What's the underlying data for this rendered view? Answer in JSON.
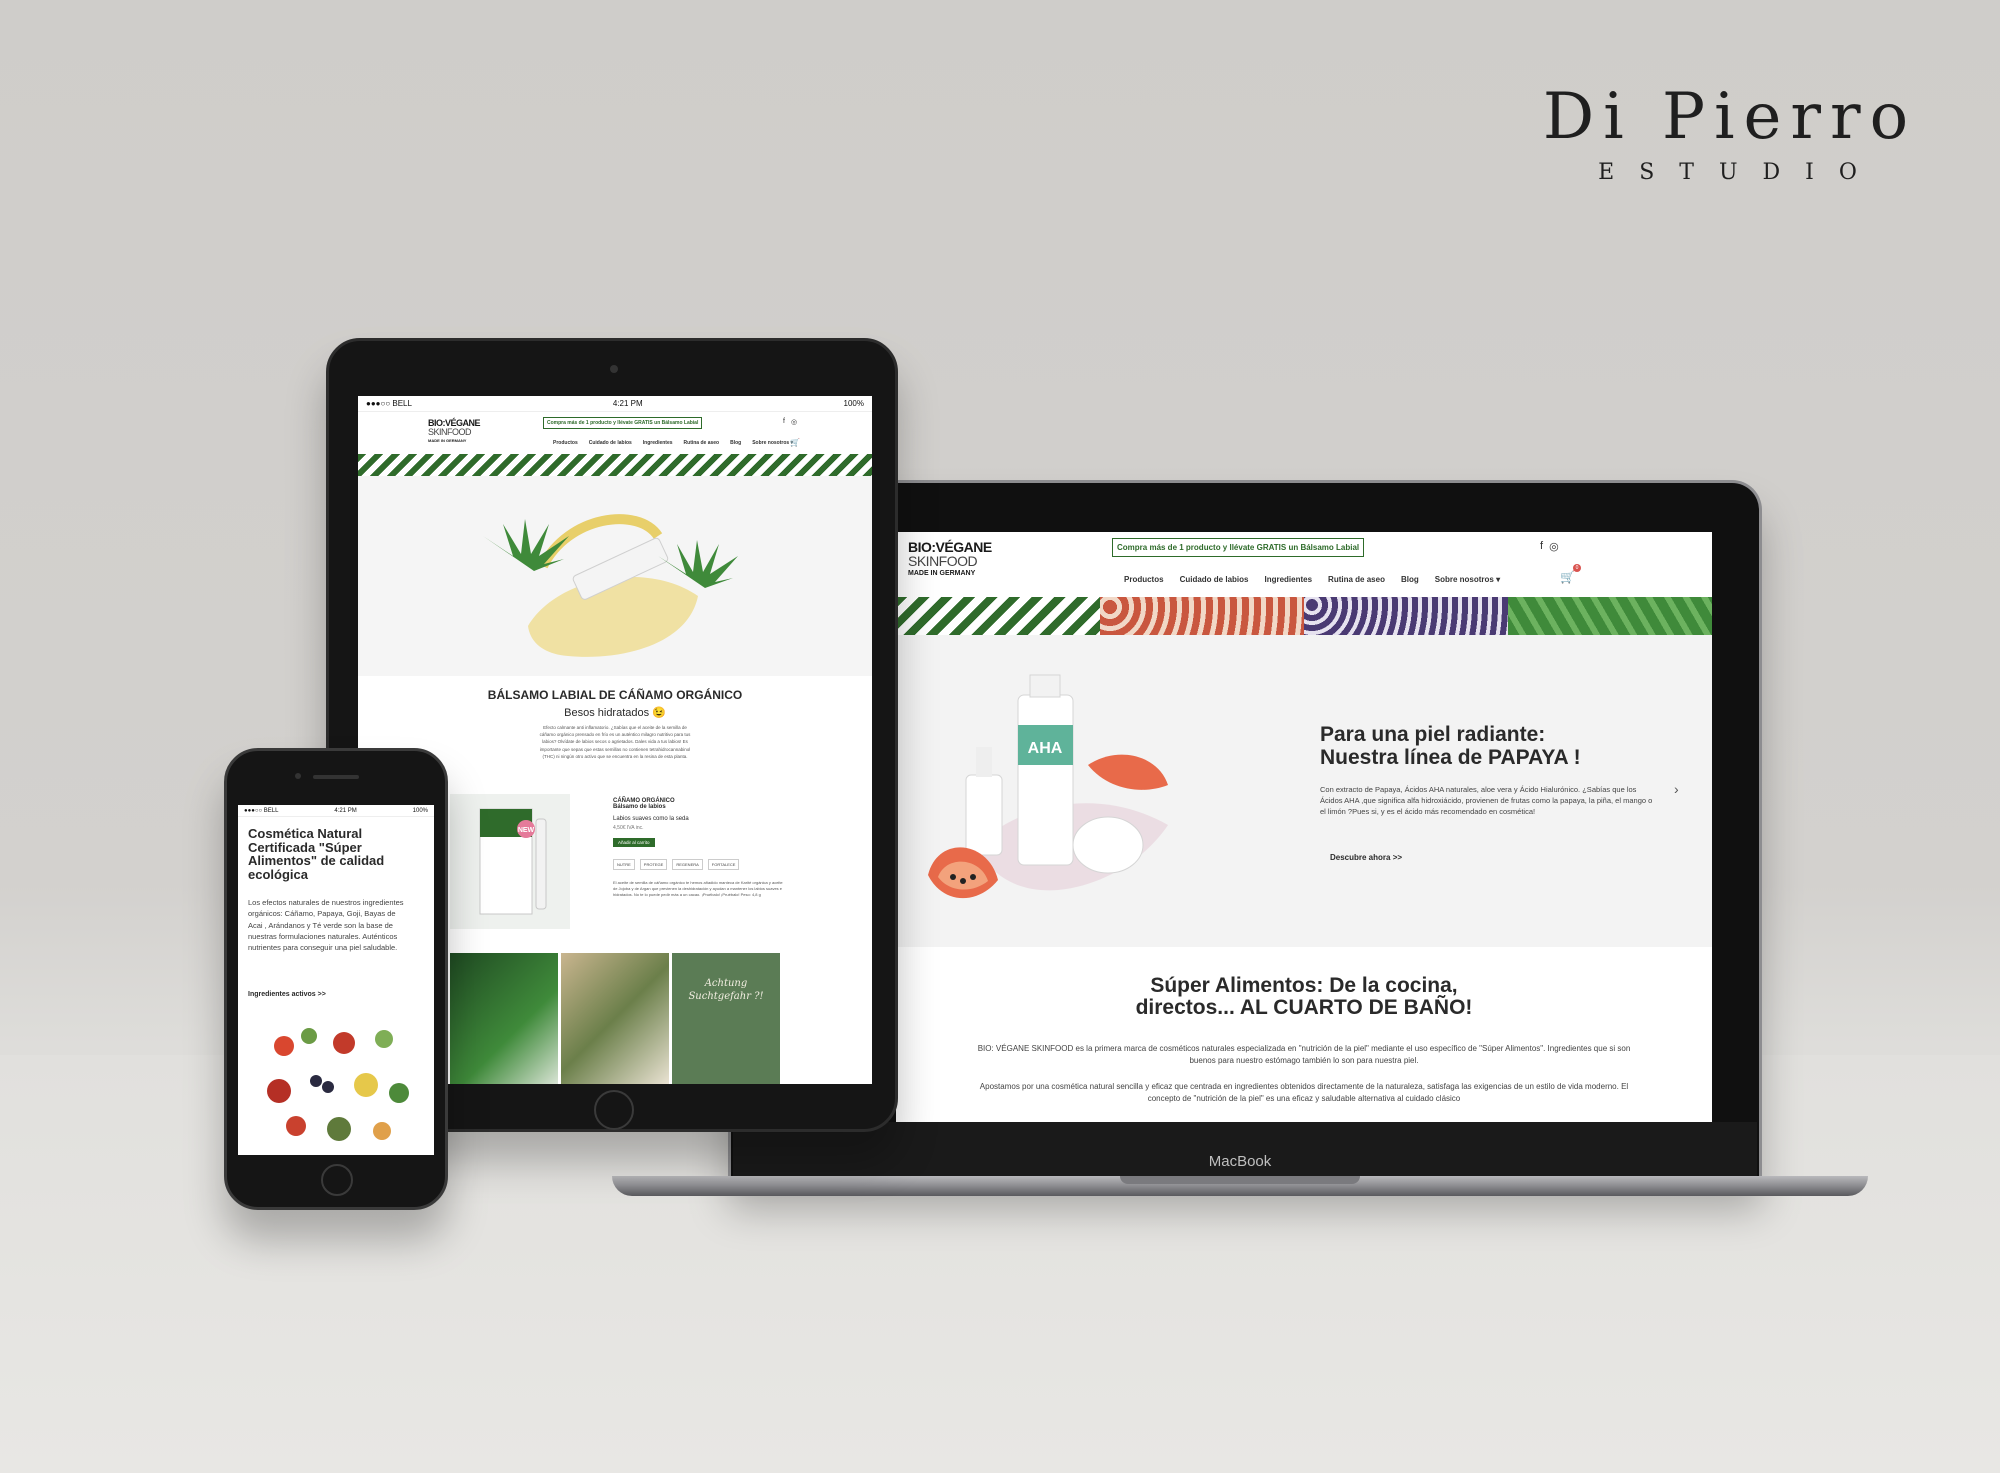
{
  "studio": {
    "name": "Di Pierro",
    "subtitle": "ESTUDIO"
  },
  "brand": {
    "logo_line1": "BIO:VÉGANE",
    "logo_line2": "SKINFOOD",
    "logo_line3": "MADE IN GERMANY"
  },
  "laptop": {
    "label": "MacBook",
    "promo": "Compra más de 1 producto y llévate GRATIS un Bálsamo Labial",
    "social_icons": [
      "facebook-icon",
      "instagram-icon"
    ],
    "nav": [
      "Productos",
      "Cuidado de labios",
      "Ingredientes",
      "Rutina de aseo",
      "Blog",
      "Sobre nosotros ▾"
    ],
    "cart_count": "0",
    "hero": {
      "title_line1": "Para una piel radiante:",
      "title_line2": "Nuestra línea de PAPAYA !",
      "text": "Con extracto de Papaya, Ácidos AHA naturales, aloe vera y Ácido Hialurónico. ¿Sabías que los Ácidos AHA ,que significa alfa hidroxiácido, provienen de frutas como la papaya, la piña, el mango o el limón ?Pues si, y es el ácido más recomendado en cosmética!",
      "cta": "Descubre ahora >>",
      "next_arrow": "›"
    },
    "section": {
      "title_line1": "Súper Alimentos: De la cocina,",
      "title_line2": "directos... AL CUARTO DE BAÑO!",
      "p1": "BIO: VÉGANE SKINFOOD es la primera marca de cosméticos naturales especializada en \"nutrición de la piel\" mediante el uso específico de \"Súper Alimentos\". Ingredientes que si son buenos para nuestro estómago también lo son para nuestra piel.",
      "p2": "Apostamos por una cosmética natural sencilla y eficaz que centrada en ingredientes obtenidos directamente de la naturaleza, satisfaga las exigencias de un estilo de vida moderno. El concepto de \"nutrición de la piel\" es una eficaz y saludable alternativa al cuidado clásico"
    }
  },
  "tablet": {
    "status": {
      "carrier": "●●●○○ BELL",
      "time": "4:21 PM",
      "battery": "100%"
    },
    "promo": "Compra más de 1 producto y llévate GRATIS un Bálsamo Labial",
    "nav": [
      "Productos",
      "Cuidado de labios",
      "Ingredientes",
      "Rutina de aseo",
      "Blog",
      "Sobre nosotros ▾"
    ],
    "title": "BÁLSAMO LABIAL DE CÁÑAMO ORGÁNICO",
    "subtitle": "Besos hidratados 😉",
    "desc": "Efecto calmante anti inflamatorio. ¿Sabías que el aceite de la semilla de cáñamo orgánico prensado en frío es un auténtico milagro nutritivo para tus labios? Olvídate de labios secos o agrietados. Dales vida a tus labios! Es importante que sepas que estas semillas no contienen tetrahidrocannabinol (THC) ni ningún otro activo que se encuentra en la resina de esta planta.",
    "product": {
      "name": "CÁÑAMO ORGÁNICO",
      "type": "Bálsamo de labios",
      "tagline": "Labios suaves como la seda",
      "price": "4,50€ IVA inc.",
      "button": "Añadir al carrito",
      "tags": [
        "NUTRE",
        "PROTEGE",
        "REGENERA",
        "FORTALECE"
      ],
      "text": "El aceite de semilla de cáñamo orgánico te hemos añadido manteca de Karité orgánica y aceite de Jojoba y de Argan que previenen la deshidratación y ayudan a mantener los labios suaves e hidratados. No te lo puede pedir más a un cacao. ¡Pruébalo! ¡Pruébalo! Peso: 4,8 g",
      "badge": "NEW"
    },
    "tile_text": "Achtung Suchtgefahr ?!"
  },
  "phone": {
    "status": {
      "carrier": "●●●○○ BELL",
      "time": "4:21 PM",
      "battery": "100%"
    },
    "title": "Cosmética Natural Certificada \"Súper Alimentos\" de calidad ecológica",
    "text": "Los efectos naturales de nuestros ingredientes orgánicos: Cáñamo, Papaya, Goji, Bayas de Acai , Arándanos y Té verde son la base de nuestras formulaciones naturales. Auténticos nutrientes para conseguir una piel saludable.",
    "link": "Ingredientes activos >>"
  },
  "colors": {
    "brand_green": "#2e6b2a",
    "papaya": "#c9573f",
    "acai": "#4a3a73"
  }
}
